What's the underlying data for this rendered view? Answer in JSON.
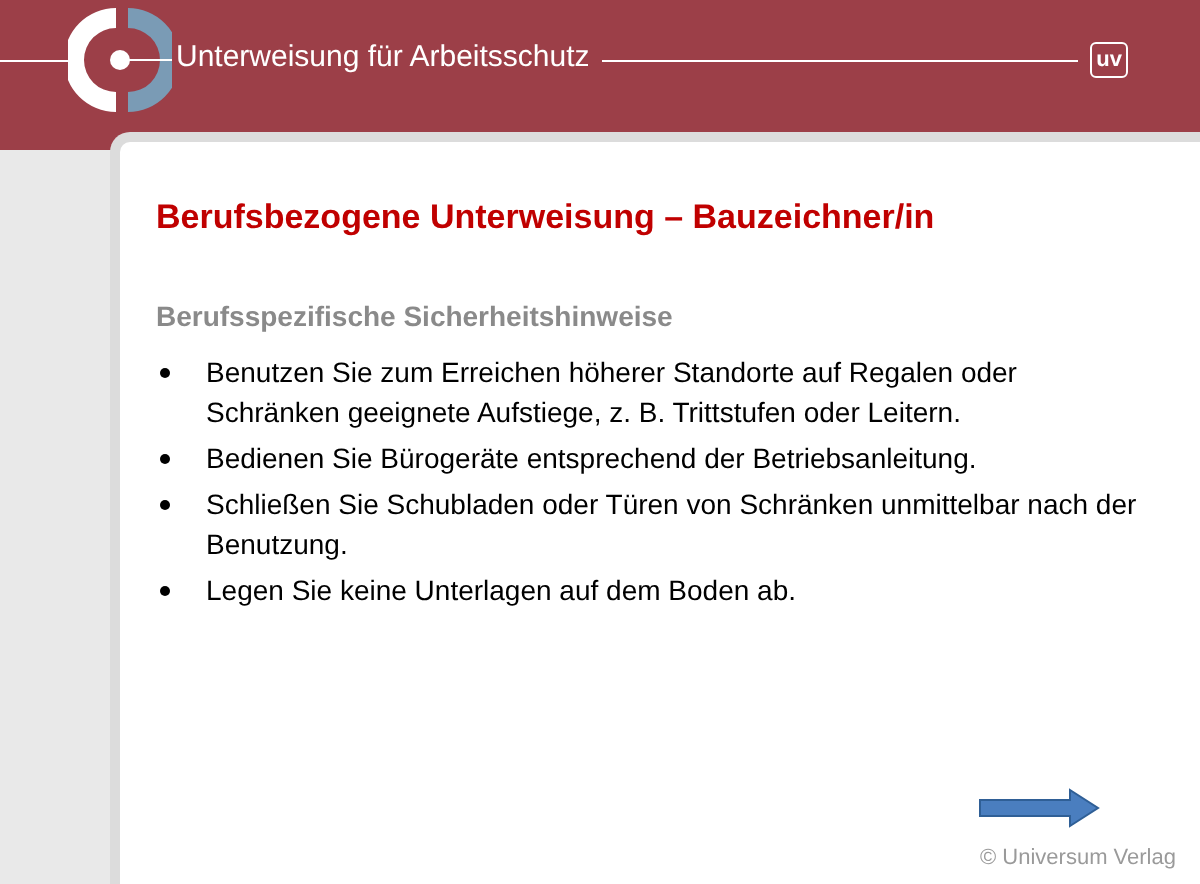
{
  "header": {
    "title": "Unterweisung für Arbeitsschutz",
    "logo_text": "uv"
  },
  "slide": {
    "title": "Berufsbezogene Unterweisung – Bauzeichner/in",
    "subtitle": "Berufsspezifische Sicherheitshinweise",
    "bullets": [
      "Benutzen Sie zum Erreichen höherer Standorte auf Regalen oder Schränken geeignete Aufstiege, z. B. Trittstufen oder Leitern.",
      "Bedienen Sie Bürogeräte entsprechend der Betriebsanleitung.",
      "Schließen Sie Schubladen oder Türen von Schränken unmittelbar nach der Benutzung.",
      "Legen Sie keine Unterlagen auf dem Boden ab."
    ]
  },
  "footer": {
    "copyright": "© Universum Verlag"
  }
}
